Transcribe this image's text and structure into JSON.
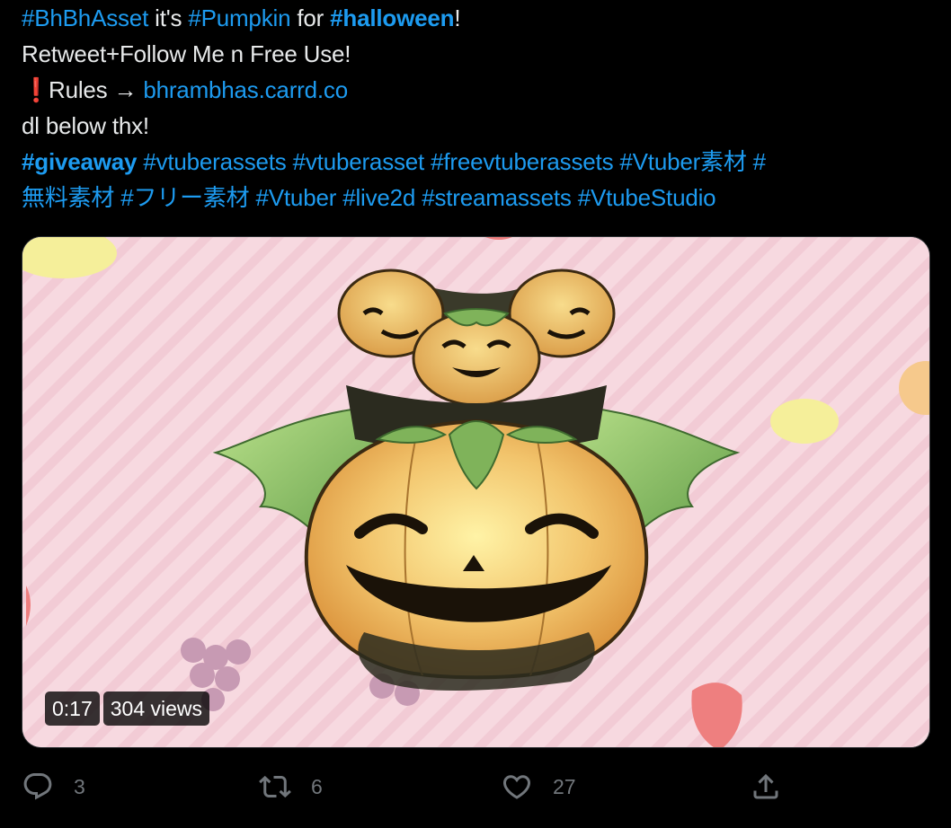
{
  "tweet": {
    "lines": [
      [
        {
          "text": "#BhBhAsset",
          "kind": "tag"
        },
        {
          "text": " it's ",
          "kind": "txt"
        },
        {
          "text": "#Pumpkin",
          "kind": "tag"
        },
        {
          "text": " for ",
          "kind": "txt"
        },
        {
          "text": "#halloween",
          "kind": "tag-bold"
        },
        {
          "text": "!",
          "kind": "txt"
        }
      ],
      [
        {
          "text": "Retweet+Follow Me n Free Use!",
          "kind": "txt"
        }
      ],
      [
        {
          "text": "❗",
          "kind": "emoji"
        },
        {
          "text": "Rules → ",
          "kind": "txt"
        },
        {
          "text": "bhrambhas.carrd.co",
          "kind": "link"
        }
      ],
      [
        {
          "text": "dl below thx!",
          "kind": "txt"
        }
      ],
      [
        {
          "text": "#giveaway",
          "kind": "tag-bold"
        },
        {
          "text": " #vtuberassets #vtuberasset #freevtuberassets #Vtuber素材 #",
          "kind": "tag"
        }
      ],
      [
        {
          "text": "無料素材 #フリー素材 #Vtuber #live2d #streamassets #VtubeStudio",
          "kind": "tag"
        }
      ]
    ]
  },
  "media": {
    "duration": "0:17",
    "views": "304 views",
    "description_icon": "pumpkin-video"
  },
  "actions": {
    "reply": {
      "icon": "reply-icon",
      "count": "3"
    },
    "retweet": {
      "icon": "retweet-icon",
      "count": "6"
    },
    "like": {
      "icon": "heart-icon",
      "count": "27"
    },
    "share": {
      "icon": "share-icon"
    }
  },
  "colors": {
    "background": "#000000",
    "text": "#e7e9ea",
    "accent": "#1d9bf0",
    "muted": "#71767b"
  }
}
